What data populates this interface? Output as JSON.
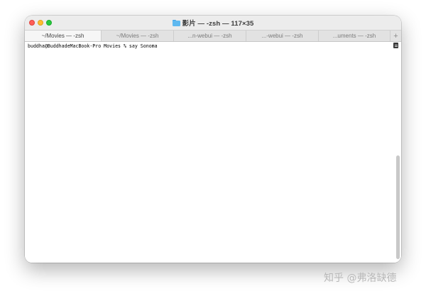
{
  "window": {
    "title": "影片 — -zsh — 117×35",
    "folder_icon": "folder-icon"
  },
  "tabs": [
    {
      "label": "~/Movies — -zsh",
      "active": true
    },
    {
      "label": "~/Movies — -zsh",
      "active": false
    },
    {
      "label": "...n-webui — -zsh",
      "active": false
    },
    {
      "label": "...-webui — -zsh",
      "active": false
    },
    {
      "label": "...uments — -zsh",
      "active": false
    }
  ],
  "new_tab_label": "+",
  "terminal": {
    "line": "buddha@BuddhadeMacBook-Pro Movies % say Sonoma"
  },
  "watermark": "知乎 @弗洛缺德",
  "colors": {
    "close": "#ff5f57",
    "minimize": "#febc2e",
    "maximize": "#28c840"
  }
}
